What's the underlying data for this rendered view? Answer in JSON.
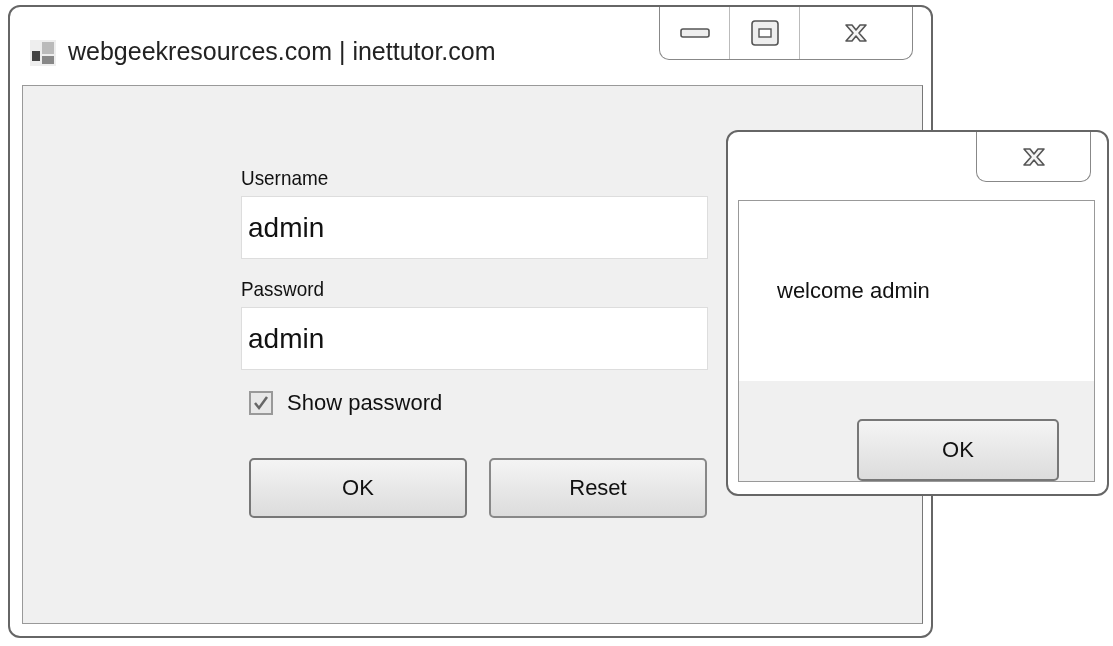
{
  "main_window": {
    "title": "webgeekresources.com | inettutor.com",
    "fields": [
      {
        "label": "Username",
        "value": "admin"
      },
      {
        "label": "Password",
        "value": "admin"
      }
    ],
    "show_password": {
      "label": "Show password",
      "checked": true
    },
    "buttons": [
      "OK",
      "Reset"
    ]
  },
  "message_box": {
    "message": "welcome admin",
    "button": "OK"
  }
}
